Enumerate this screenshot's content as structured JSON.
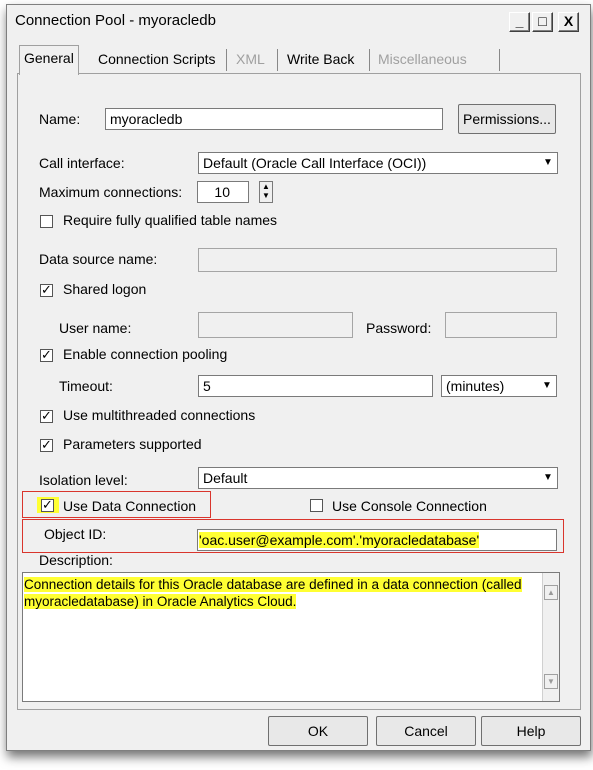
{
  "window": {
    "title": "Connection Pool - myoracledb"
  },
  "titlebar_buttons": {
    "minimize": "_",
    "maximize": "□",
    "close": "X"
  },
  "tabs": [
    {
      "label": "General",
      "active": true,
      "enabled": true
    },
    {
      "label": "Connection Scripts",
      "active": false,
      "enabled": true
    },
    {
      "label": "XML",
      "active": false,
      "enabled": false
    },
    {
      "label": "Write Back",
      "active": false,
      "enabled": true
    },
    {
      "label": "Miscellaneous",
      "active": false,
      "enabled": false
    }
  ],
  "general": {
    "name_label": "Name:",
    "name_value": "myoracledb",
    "permissions_label": "Permissions...",
    "call_interface_label": "Call interface:",
    "call_interface_value": "Default (Oracle Call Interface (OCI))",
    "max_connections_label": "Maximum connections:",
    "max_connections_value": "10",
    "require_qualified_label": "Require fully qualified table names",
    "require_qualified_checked": false,
    "data_source_label": "Data source name:",
    "data_source_value": "",
    "shared_logon_label": "Shared logon",
    "shared_logon_checked": true,
    "user_name_label": "User name:",
    "user_name_value": "",
    "password_label": "Password:",
    "password_value": "",
    "enable_pooling_label": "Enable connection pooling",
    "enable_pooling_checked": true,
    "timeout_label": "Timeout:",
    "timeout_value": "5",
    "timeout_unit": "(minutes)",
    "multithreaded_label": "Use multithreaded connections",
    "multithreaded_checked": true,
    "params_supported_label": "Parameters supported",
    "params_supported_checked": true,
    "isolation_label": "Isolation level:",
    "isolation_value": "Default",
    "use_data_connection_label": "Use Data Connection",
    "use_data_connection_checked": true,
    "use_console_connection_label": "Use Console Connection",
    "use_console_connection_checked": false,
    "object_id_label": "Object ID:",
    "object_id_value": "'oac.user@example.com'.'myoracledatabase'",
    "description_label": "Description:",
    "description_value": "Connection details for this Oracle database are defined in a data connection (called myoracledatabase) in Oracle Analytics Cloud."
  },
  "footer": {
    "ok_label": "OK",
    "cancel_label": "Cancel",
    "help_label": "Help"
  },
  "colors": {
    "highlight": "#ffff33",
    "callout_border": "#d9352d",
    "dialog_bg": "#f0f0f0"
  }
}
